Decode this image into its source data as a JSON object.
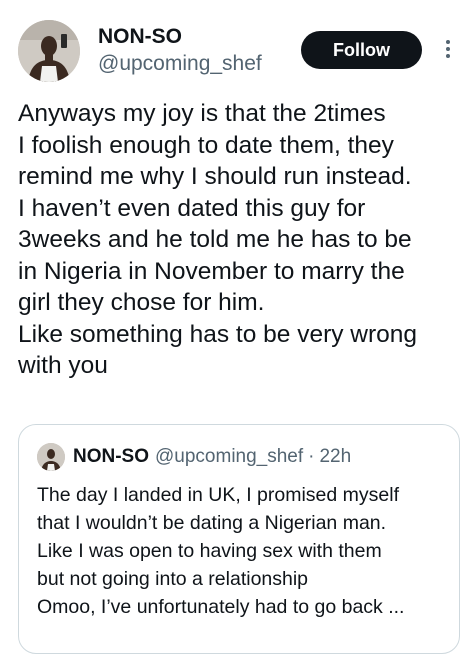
{
  "tweet": {
    "author": {
      "display_name": "NON-SO",
      "handle": "@upcoming_shef"
    },
    "follow_label": "Follow",
    "more_icon": "more-horizontal-icon",
    "text_lines": [
      "Anyways my joy is that the 2times",
      "I foolish enough to date them, they",
      "remind me why I should run instead.",
      "I haven’t even dated this guy for",
      "3weeks and he told me he has to be",
      "in Nigeria in November to marry the",
      "girl they chose for him.",
      "Like something has to be very wrong",
      "with you"
    ]
  },
  "quote": {
    "author": {
      "display_name": "NON-SO",
      "handle": "@upcoming_shef",
      "separator": "·",
      "time": "22h"
    },
    "text_lines": [
      "The day I landed in UK, I promised myself",
      "that I wouldn’t be dating a Nigerian man.",
      "Like I was open to having sex with them",
      "but not going into a relationship",
      "Omoo, I’ve unfortunately had to go back ..."
    ]
  },
  "colors": {
    "text_primary": "#0f1419",
    "text_secondary": "#536471",
    "follow_bg": "#0f1419",
    "border": "#cfd9de"
  }
}
